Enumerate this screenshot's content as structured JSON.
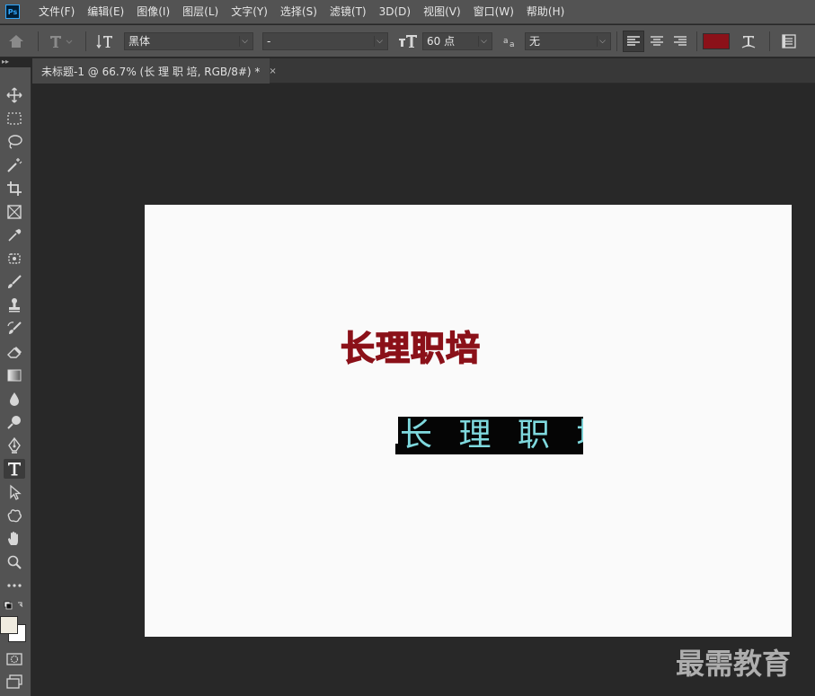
{
  "app": {
    "logo": "Ps"
  },
  "menu": [
    "文件(F)",
    "编辑(E)",
    "图像(I)",
    "图层(L)",
    "文字(Y)",
    "选择(S)",
    "滤镜(T)",
    "3D(D)",
    "视图(V)",
    "窗口(W)",
    "帮助(H)"
  ],
  "options": {
    "font_family": "黑体",
    "font_style": "-",
    "font_size": "60 点",
    "antialias": "无",
    "text_color": "#8b1119"
  },
  "document": {
    "tab_title": "未标题-1 @ 66.7% (长 理 职 培, RGB/8#) *",
    "close_glyph": "×"
  },
  "canvas": {
    "text_layer_1": "长理职培",
    "text_layer_1_color": "#8b1119",
    "text_layer_2": "长 理 职 培",
    "text_layer_2_color": "#7fd9de"
  },
  "watermark": "最需教育",
  "colors": {
    "foreground": "#f0ece0",
    "background": "#ffffff"
  },
  "toolbar_grip": "▸▸"
}
